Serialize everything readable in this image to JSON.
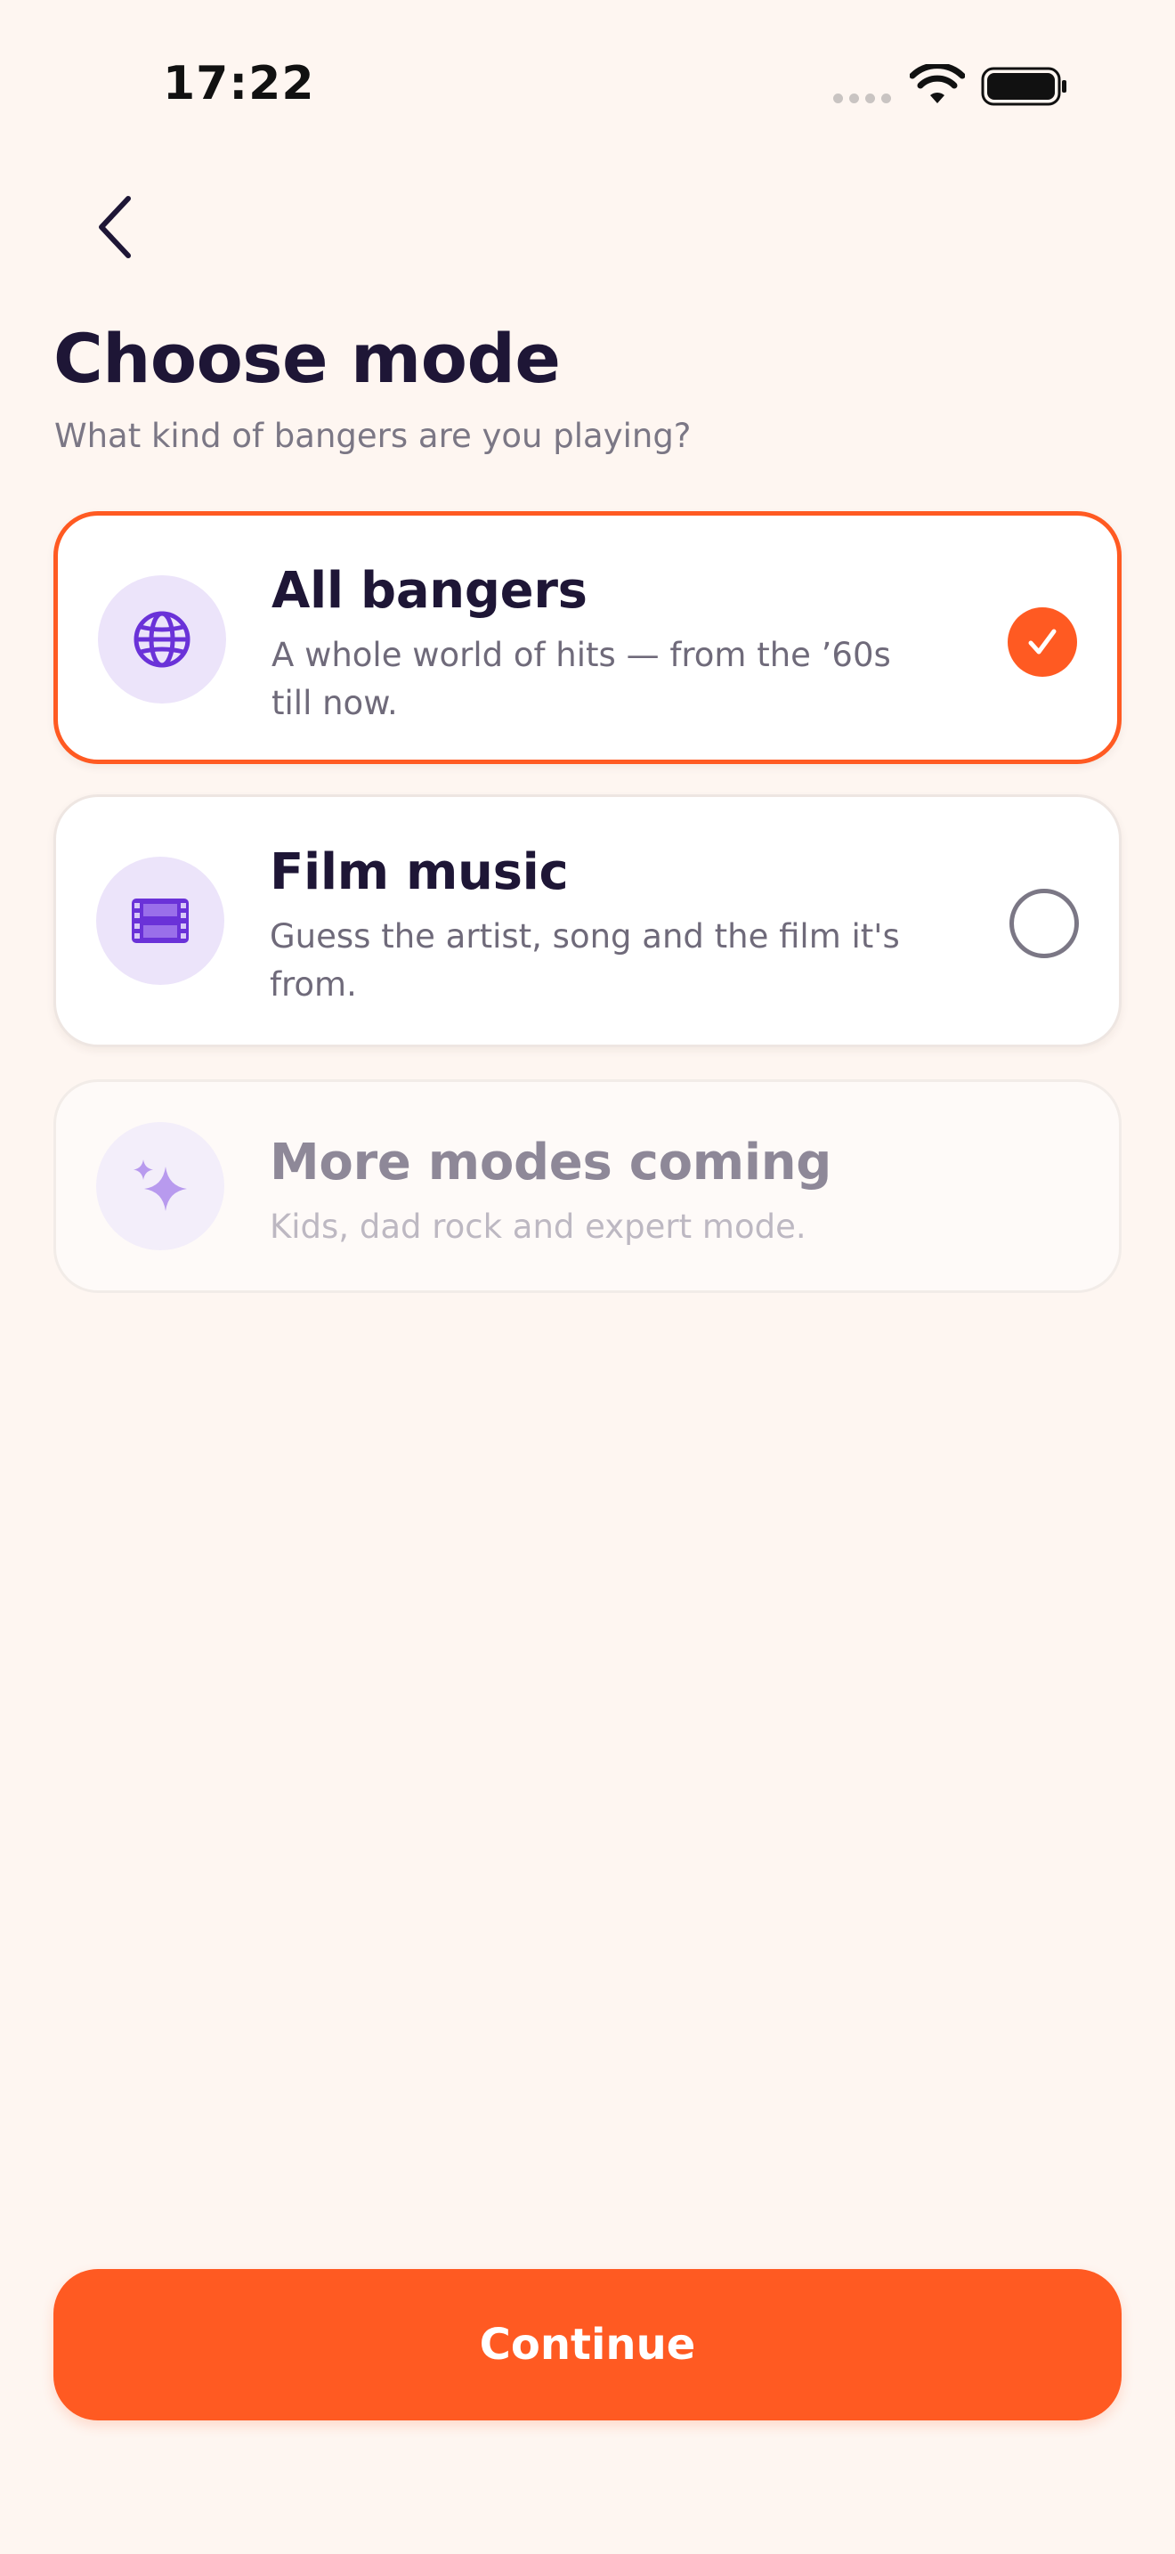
{
  "status_bar": {
    "time": "17:22"
  },
  "nav": {
    "back_icon": "chevron-left-icon"
  },
  "header": {
    "title": "Choose mode",
    "subtitle": "What kind of bangers are you playing?"
  },
  "modes": [
    {
      "title": "All bangers",
      "description": "A whole world of hits — from the ’60s till now.",
      "icon": "globe-icon",
      "state": "selected"
    },
    {
      "title": "Film music",
      "description": "Guess the artist, song and the film it's from.",
      "icon": "film-icon",
      "state": "unselected"
    },
    {
      "title": "More modes coming",
      "description": "Kids, dad rock and expert mode.",
      "icon": "sparkles-icon",
      "state": "disabled"
    }
  ],
  "footer": {
    "continue_label": "Continue"
  },
  "colors": {
    "accent": "#FF5A22",
    "background": "#FEF6F1",
    "icon_tint": "#6A32D8",
    "icon_bg": "#ECE4FA",
    "text_primary": "#1E1636",
    "text_secondary": "#6F6A7A"
  }
}
